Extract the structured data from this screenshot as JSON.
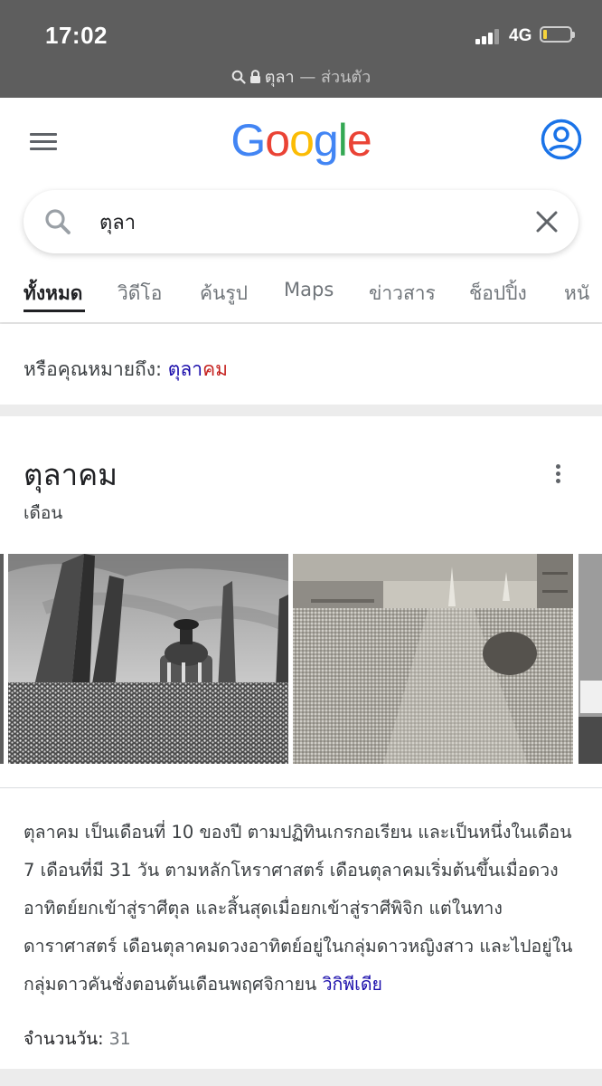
{
  "status_bar": {
    "time": "17:02",
    "network": "4G",
    "url_query": "ตุลา",
    "url_suffix": "— ส่วนตัว"
  },
  "header": {
    "logo_letters": [
      "G",
      "o",
      "o",
      "g",
      "l",
      "e"
    ],
    "logo_colors": [
      "#4285f4",
      "#ea4335",
      "#fbbc05",
      "#4285f4",
      "#34a853",
      "#ea4335"
    ]
  },
  "search": {
    "value": "ตุลา",
    "icons": {
      "leading": "search-icon",
      "trailing": "close-icon"
    }
  },
  "tabs": [
    {
      "label": "ทั้งหมด",
      "active": true
    },
    {
      "label": "วิดีโอ",
      "active": false
    },
    {
      "label": "ค้นรูป",
      "active": false
    },
    {
      "label": "Maps",
      "active": false
    },
    {
      "label": "ข่าวสาร",
      "active": false
    },
    {
      "label": "ช็อปปิ้ง",
      "active": false
    },
    {
      "label": "หนั",
      "active": false
    }
  ],
  "did_you_mean": {
    "prefix": "หรือคุณหมายถึง:",
    "link_plain": "ตุลา",
    "link_highlight": "คม"
  },
  "knowledge_panel": {
    "title": "ตุลาคม",
    "subtitle": "เดือน",
    "description": "ตุลาคม เป็นเดือนที่ 10 ของปี ตามปฏิทินเกรกอเรียน และเป็นหนึ่งในเดือน 7 เดือนที่มี 31 วัน ตามหลักโหราศาสตร์ เดือนตุลาคมเริ่มต้นขึ้นเมื่อดวงอาทิตย์ยกเข้าสู่ราศีตุล และสิ้นสุดเมื่อยกเข้าสู่ราศีพิจิก แต่ในทางดาราศาสตร์ เดือนตุลาคมดวงอาทิตย์อยู่ในกลุ่มดาวหญิงสาว และไปอยู่ในกลุ่มดาวคันชั่งตอนต้นเดือนพฤศจิกายน",
    "source_link": "วิกิพีเดีย",
    "days_label": "จำนวนวัน:",
    "days_value": "31"
  },
  "colors": {
    "status_bar_bg": "#5e5e5e",
    "link_blue": "#1a0dab",
    "highlight_red": "#c5221f",
    "account_blue": "#1a73e8"
  }
}
